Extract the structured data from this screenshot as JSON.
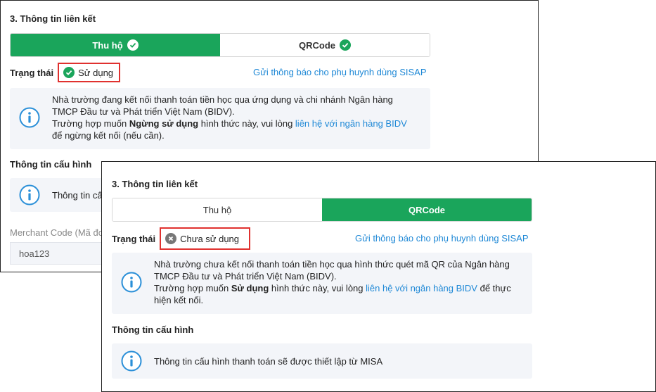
{
  "panel_enabled": {
    "section_title": "3. Thông tin liên kết",
    "tabs": [
      {
        "label": "Thu hộ",
        "active": true
      },
      {
        "label": "QRCode",
        "active": false
      }
    ],
    "status_label": "Trạng thái",
    "status_value": "Sử dụng",
    "notify_link": "Gửi thông báo cho phụ huynh dùng SISAP",
    "info": {
      "line1": "Nhà trường đang kết nối thanh toán tiền học qua ứng dụng và chi nhánh Ngân hàng",
      "line2": "TMCP Đầu tư và Phát triển Việt Nam (BIDV).",
      "line3_prefix": "Trường hợp muốn ",
      "line3_bold": "Ngừng sử dụng",
      "line3_mid": " hình thức này, vui lòng ",
      "line3_link": "liên hệ với ngân hàng BIDV",
      "line4": "để ngừng kết nối (nếu cần)."
    },
    "config_title": "Thông tin cấu hình",
    "config_info_partial": "Thông tin cấ",
    "merchant_label_partial": "Merchant Code (Mã đơn",
    "merchant_value": "hoa123"
  },
  "panel_disabled": {
    "section_title": "3. Thông tin liên kết",
    "tabs": [
      {
        "label": "Thu hộ",
        "active": false
      },
      {
        "label": "QRCode",
        "active": true
      }
    ],
    "status_label": "Trạng thái",
    "status_value": "Chưa sử dụng",
    "notify_link": "Gửi thông báo cho phụ huynh dùng SISAP",
    "info": {
      "line1": "Nhà trường chưa kết nối thanh toán tiền học qua hình thức quét mã QR của Ngân hàng",
      "line2": "TMCP Đầu tư và Phát triển Việt Nam (BIDV).",
      "line3_prefix": "Trường hợp muốn ",
      "line3_bold": "Sử dụng",
      "line3_mid": " hình thức này, vui lòng ",
      "line3_link": "liên hệ với ngân hàng BIDV",
      "line3_suffix": " để thực",
      "line4": "hiện kết nối."
    },
    "config_title": "Thông tin cấu hình",
    "config_info": "Thông tin cấu hình thanh toán sẽ được thiết lập từ MISA"
  },
  "colors": {
    "accent": "#1aa55b",
    "highlight": "#e0312f",
    "link": "#1e88d6",
    "info_bg": "#f3f5f9"
  }
}
